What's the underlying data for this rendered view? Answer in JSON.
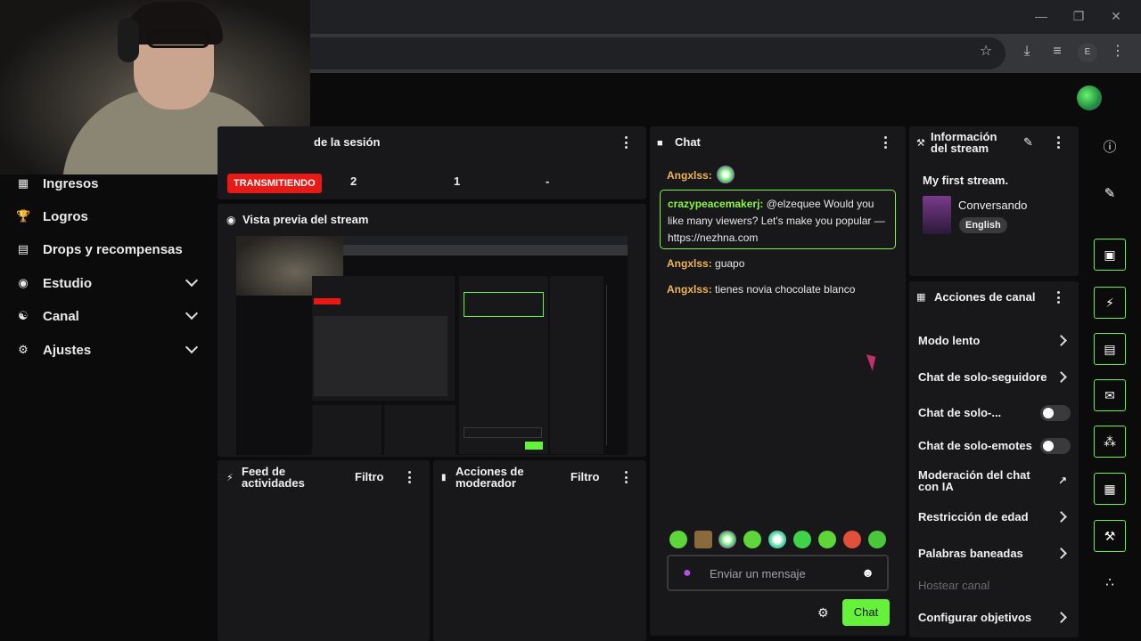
{
  "browser": {
    "extension_initial": "E",
    "window_controls": [
      "minimize",
      "restore",
      "close"
    ]
  },
  "sidebar": {
    "items": [
      {
        "label": "Ingresos",
        "icon": "chart-icon",
        "expandable": false
      },
      {
        "label": "Logros",
        "icon": "trophy-icon",
        "expandable": false
      },
      {
        "label": "Drops y recompensas",
        "icon": "gift-icon",
        "expandable": false
      },
      {
        "label": "Estudio",
        "icon": "camera-icon",
        "expandable": true
      },
      {
        "label": "Canal",
        "icon": "broadcast-icon",
        "expandable": true
      },
      {
        "label": "Ajustes",
        "icon": "gear-icon",
        "expandable": true
      }
    ]
  },
  "session": {
    "title": "de la sesión",
    "status_badge": "TRANSMITIENDO",
    "stats": [
      "2",
      "1",
      "-"
    ]
  },
  "preview": {
    "title": "Vista previa del stream"
  },
  "activity_feed": {
    "title_line1": "Feed de",
    "title_line2": "actividades",
    "filter": "Filtro"
  },
  "mod_actions": {
    "title_line1": "Acciones de",
    "title_line2": "moderador",
    "filter": "Filtro"
  },
  "chat": {
    "title": "Chat",
    "messages": [
      {
        "user": "Angxlss",
        "text": ""
      },
      {
        "user": "crazypeacemakerj",
        "text": "@elzequee Would you like many viewers? Let's make you popular — https://nezhna.com",
        "highlighted": true
      },
      {
        "user": "Angxlss",
        "text": "guapo"
      },
      {
        "user": "Angxlss",
        "text": "tienes novia chocolate blanco"
      }
    ],
    "input_placeholder": "Enviar un mensaje",
    "send_label": "Chat"
  },
  "stream_info": {
    "title_line1": "Información",
    "title_line2": "del stream",
    "stream_title": "My first stream.",
    "category": "Conversando",
    "tag": "English"
  },
  "channel_actions": {
    "title": "Acciones de canal",
    "items": [
      {
        "label": "Modo lento",
        "control": "chevron"
      },
      {
        "label": "Chat de solo-seguidore",
        "control": "chevron"
      },
      {
        "label": "Chat de solo-...",
        "control": "toggle",
        "on": false
      },
      {
        "label": "Chat de solo-emotes",
        "control": "toggle",
        "on": false
      },
      {
        "label_line1": "Moderación del chat",
        "label_line2": "con IA",
        "control": "external"
      },
      {
        "label": "Restricción de edad",
        "control": "chevron"
      },
      {
        "label": "Palabras baneadas",
        "control": "chevron"
      },
      {
        "label": "Hostear canal",
        "control": "none",
        "disabled": true
      },
      {
        "label": "Configurar objetivos",
        "control": "chevron"
      }
    ]
  },
  "colors": {
    "accent": "#65f23a",
    "live": "#e91916",
    "panel": "#18181b",
    "username": "#f0b454"
  }
}
